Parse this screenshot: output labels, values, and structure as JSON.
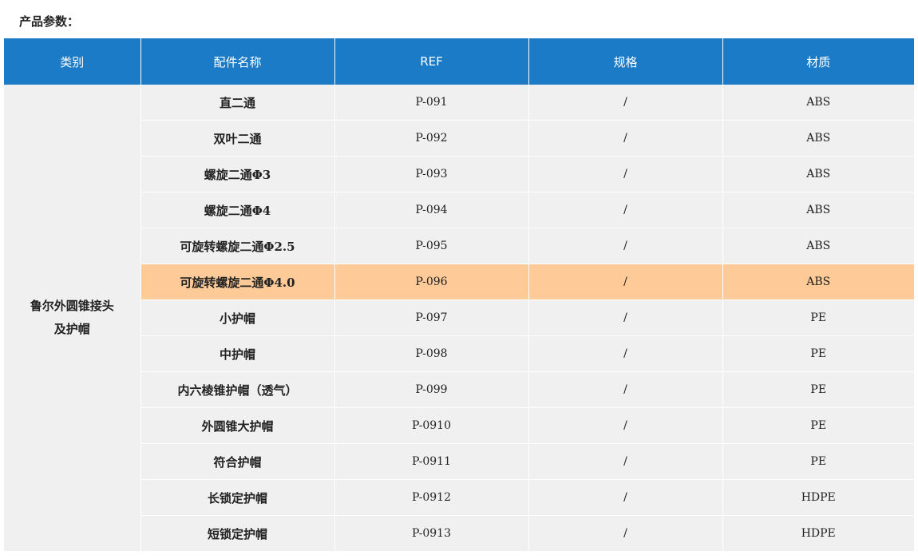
{
  "section_title": "产品参数：",
  "headers": [
    "类别",
    "配件名称",
    "REF",
    "规格",
    "材质"
  ],
  "category": "鲁尔外圆锥接头\n及护帽",
  "highlight_color": "#fecb98",
  "header_color": "#1b7bc6",
  "rows": [
    {
      "name": "直二通",
      "ref": "P-091",
      "spec": "/",
      "material": "ABS",
      "highlighted": false
    },
    {
      "name": "双叶二通",
      "ref": "P-092",
      "spec": "/",
      "material": "ABS",
      "highlighted": false
    },
    {
      "name": "螺旋二通Φ3",
      "ref": "P-093",
      "spec": "/",
      "material": "ABS",
      "highlighted": false
    },
    {
      "name": "螺旋二通Φ4",
      "ref": "P-094",
      "spec": "/",
      "material": "ABS",
      "highlighted": false
    },
    {
      "name": "可旋转螺旋二通Φ2.5",
      "ref": "P-095",
      "spec": "/",
      "material": "ABS",
      "highlighted": false
    },
    {
      "name": "可旋转螺旋二通Φ4.0",
      "ref": "P-096",
      "spec": "/",
      "material": "ABS",
      "highlighted": true
    },
    {
      "name": "小护帽",
      "ref": "P-097",
      "spec": "/",
      "material": "PE",
      "highlighted": false
    },
    {
      "name": "中护帽",
      "ref": "P-098",
      "spec": "/",
      "material": "PE",
      "highlighted": false
    },
    {
      "name": "内六棱锥护帽（透气）",
      "ref": "P-099",
      "spec": "/",
      "material": "PE",
      "highlighted": false
    },
    {
      "name": "外圆锥大护帽",
      "ref": "P-0910",
      "spec": "/",
      "material": "PE",
      "highlighted": false
    },
    {
      "name": "符合护帽",
      "ref": "P-0911",
      "spec": "/",
      "material": "PE",
      "highlighted": false
    },
    {
      "name": "长锁定护帽",
      "ref": "P-0912",
      "spec": "/",
      "material": "HDPE",
      "highlighted": false
    },
    {
      "name": "短锁定护帽",
      "ref": "P-0913",
      "spec": "/",
      "material": "HDPE",
      "highlighted": false
    }
  ]
}
